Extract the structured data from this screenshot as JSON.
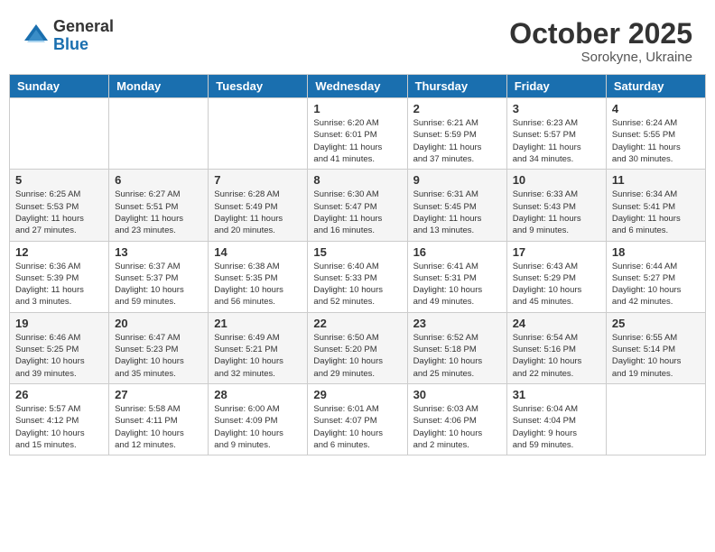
{
  "header": {
    "logo_general": "General",
    "logo_blue": "Blue",
    "month_title": "October 2025",
    "subtitle": "Sorokyne, Ukraine"
  },
  "weekdays": [
    "Sunday",
    "Monday",
    "Tuesday",
    "Wednesday",
    "Thursday",
    "Friday",
    "Saturday"
  ],
  "weeks": [
    [
      {
        "day": "",
        "info": ""
      },
      {
        "day": "",
        "info": ""
      },
      {
        "day": "",
        "info": ""
      },
      {
        "day": "1",
        "info": "Sunrise: 6:20 AM\nSunset: 6:01 PM\nDaylight: 11 hours\nand 41 minutes."
      },
      {
        "day": "2",
        "info": "Sunrise: 6:21 AM\nSunset: 5:59 PM\nDaylight: 11 hours\nand 37 minutes."
      },
      {
        "day": "3",
        "info": "Sunrise: 6:23 AM\nSunset: 5:57 PM\nDaylight: 11 hours\nand 34 minutes."
      },
      {
        "day": "4",
        "info": "Sunrise: 6:24 AM\nSunset: 5:55 PM\nDaylight: 11 hours\nand 30 minutes."
      }
    ],
    [
      {
        "day": "5",
        "info": "Sunrise: 6:25 AM\nSunset: 5:53 PM\nDaylight: 11 hours\nand 27 minutes."
      },
      {
        "day": "6",
        "info": "Sunrise: 6:27 AM\nSunset: 5:51 PM\nDaylight: 11 hours\nand 23 minutes."
      },
      {
        "day": "7",
        "info": "Sunrise: 6:28 AM\nSunset: 5:49 PM\nDaylight: 11 hours\nand 20 minutes."
      },
      {
        "day": "8",
        "info": "Sunrise: 6:30 AM\nSunset: 5:47 PM\nDaylight: 11 hours\nand 16 minutes."
      },
      {
        "day": "9",
        "info": "Sunrise: 6:31 AM\nSunset: 5:45 PM\nDaylight: 11 hours\nand 13 minutes."
      },
      {
        "day": "10",
        "info": "Sunrise: 6:33 AM\nSunset: 5:43 PM\nDaylight: 11 hours\nand 9 minutes."
      },
      {
        "day": "11",
        "info": "Sunrise: 6:34 AM\nSunset: 5:41 PM\nDaylight: 11 hours\nand 6 minutes."
      }
    ],
    [
      {
        "day": "12",
        "info": "Sunrise: 6:36 AM\nSunset: 5:39 PM\nDaylight: 11 hours\nand 3 minutes."
      },
      {
        "day": "13",
        "info": "Sunrise: 6:37 AM\nSunset: 5:37 PM\nDaylight: 10 hours\nand 59 minutes."
      },
      {
        "day": "14",
        "info": "Sunrise: 6:38 AM\nSunset: 5:35 PM\nDaylight: 10 hours\nand 56 minutes."
      },
      {
        "day": "15",
        "info": "Sunrise: 6:40 AM\nSunset: 5:33 PM\nDaylight: 10 hours\nand 52 minutes."
      },
      {
        "day": "16",
        "info": "Sunrise: 6:41 AM\nSunset: 5:31 PM\nDaylight: 10 hours\nand 49 minutes."
      },
      {
        "day": "17",
        "info": "Sunrise: 6:43 AM\nSunset: 5:29 PM\nDaylight: 10 hours\nand 45 minutes."
      },
      {
        "day": "18",
        "info": "Sunrise: 6:44 AM\nSunset: 5:27 PM\nDaylight: 10 hours\nand 42 minutes."
      }
    ],
    [
      {
        "day": "19",
        "info": "Sunrise: 6:46 AM\nSunset: 5:25 PM\nDaylight: 10 hours\nand 39 minutes."
      },
      {
        "day": "20",
        "info": "Sunrise: 6:47 AM\nSunset: 5:23 PM\nDaylight: 10 hours\nand 35 minutes."
      },
      {
        "day": "21",
        "info": "Sunrise: 6:49 AM\nSunset: 5:21 PM\nDaylight: 10 hours\nand 32 minutes."
      },
      {
        "day": "22",
        "info": "Sunrise: 6:50 AM\nSunset: 5:20 PM\nDaylight: 10 hours\nand 29 minutes."
      },
      {
        "day": "23",
        "info": "Sunrise: 6:52 AM\nSunset: 5:18 PM\nDaylight: 10 hours\nand 25 minutes."
      },
      {
        "day": "24",
        "info": "Sunrise: 6:54 AM\nSunset: 5:16 PM\nDaylight: 10 hours\nand 22 minutes."
      },
      {
        "day": "25",
        "info": "Sunrise: 6:55 AM\nSunset: 5:14 PM\nDaylight: 10 hours\nand 19 minutes."
      }
    ],
    [
      {
        "day": "26",
        "info": "Sunrise: 5:57 AM\nSunset: 4:12 PM\nDaylight: 10 hours\nand 15 minutes."
      },
      {
        "day": "27",
        "info": "Sunrise: 5:58 AM\nSunset: 4:11 PM\nDaylight: 10 hours\nand 12 minutes."
      },
      {
        "day": "28",
        "info": "Sunrise: 6:00 AM\nSunset: 4:09 PM\nDaylight: 10 hours\nand 9 minutes."
      },
      {
        "day": "29",
        "info": "Sunrise: 6:01 AM\nSunset: 4:07 PM\nDaylight: 10 hours\nand 6 minutes."
      },
      {
        "day": "30",
        "info": "Sunrise: 6:03 AM\nSunset: 4:06 PM\nDaylight: 10 hours\nand 2 minutes."
      },
      {
        "day": "31",
        "info": "Sunrise: 6:04 AM\nSunset: 4:04 PM\nDaylight: 9 hours\nand 59 minutes."
      },
      {
        "day": "",
        "info": ""
      }
    ]
  ]
}
